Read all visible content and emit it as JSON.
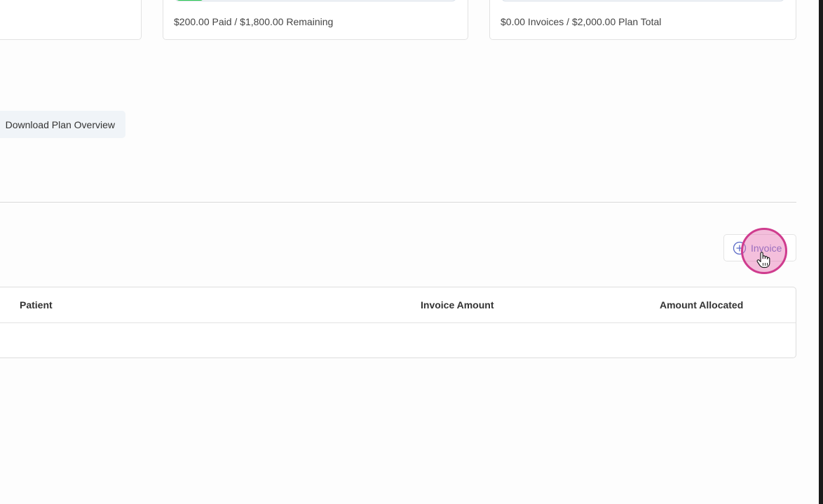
{
  "summary_cards": {
    "payments": {
      "text": "$200.00 Paid / $1,800.00 Remaining",
      "progress": 0.1
    },
    "invoices": {
      "text": "$0.00 Invoices / $2,000.00 Plan Total",
      "progress": 0.0
    }
  },
  "actions": {
    "download_label": "Download Plan Overview"
  },
  "invoices_section": {
    "add_button_label": "Invoice",
    "columns": [
      "Patient",
      "Invoice Amount",
      "Amount Allocated"
    ],
    "rows": []
  },
  "colors": {
    "progress_fill": "#2ecc52",
    "accent": "#5b6bc7",
    "click_indicator": "#cf3c8e"
  }
}
